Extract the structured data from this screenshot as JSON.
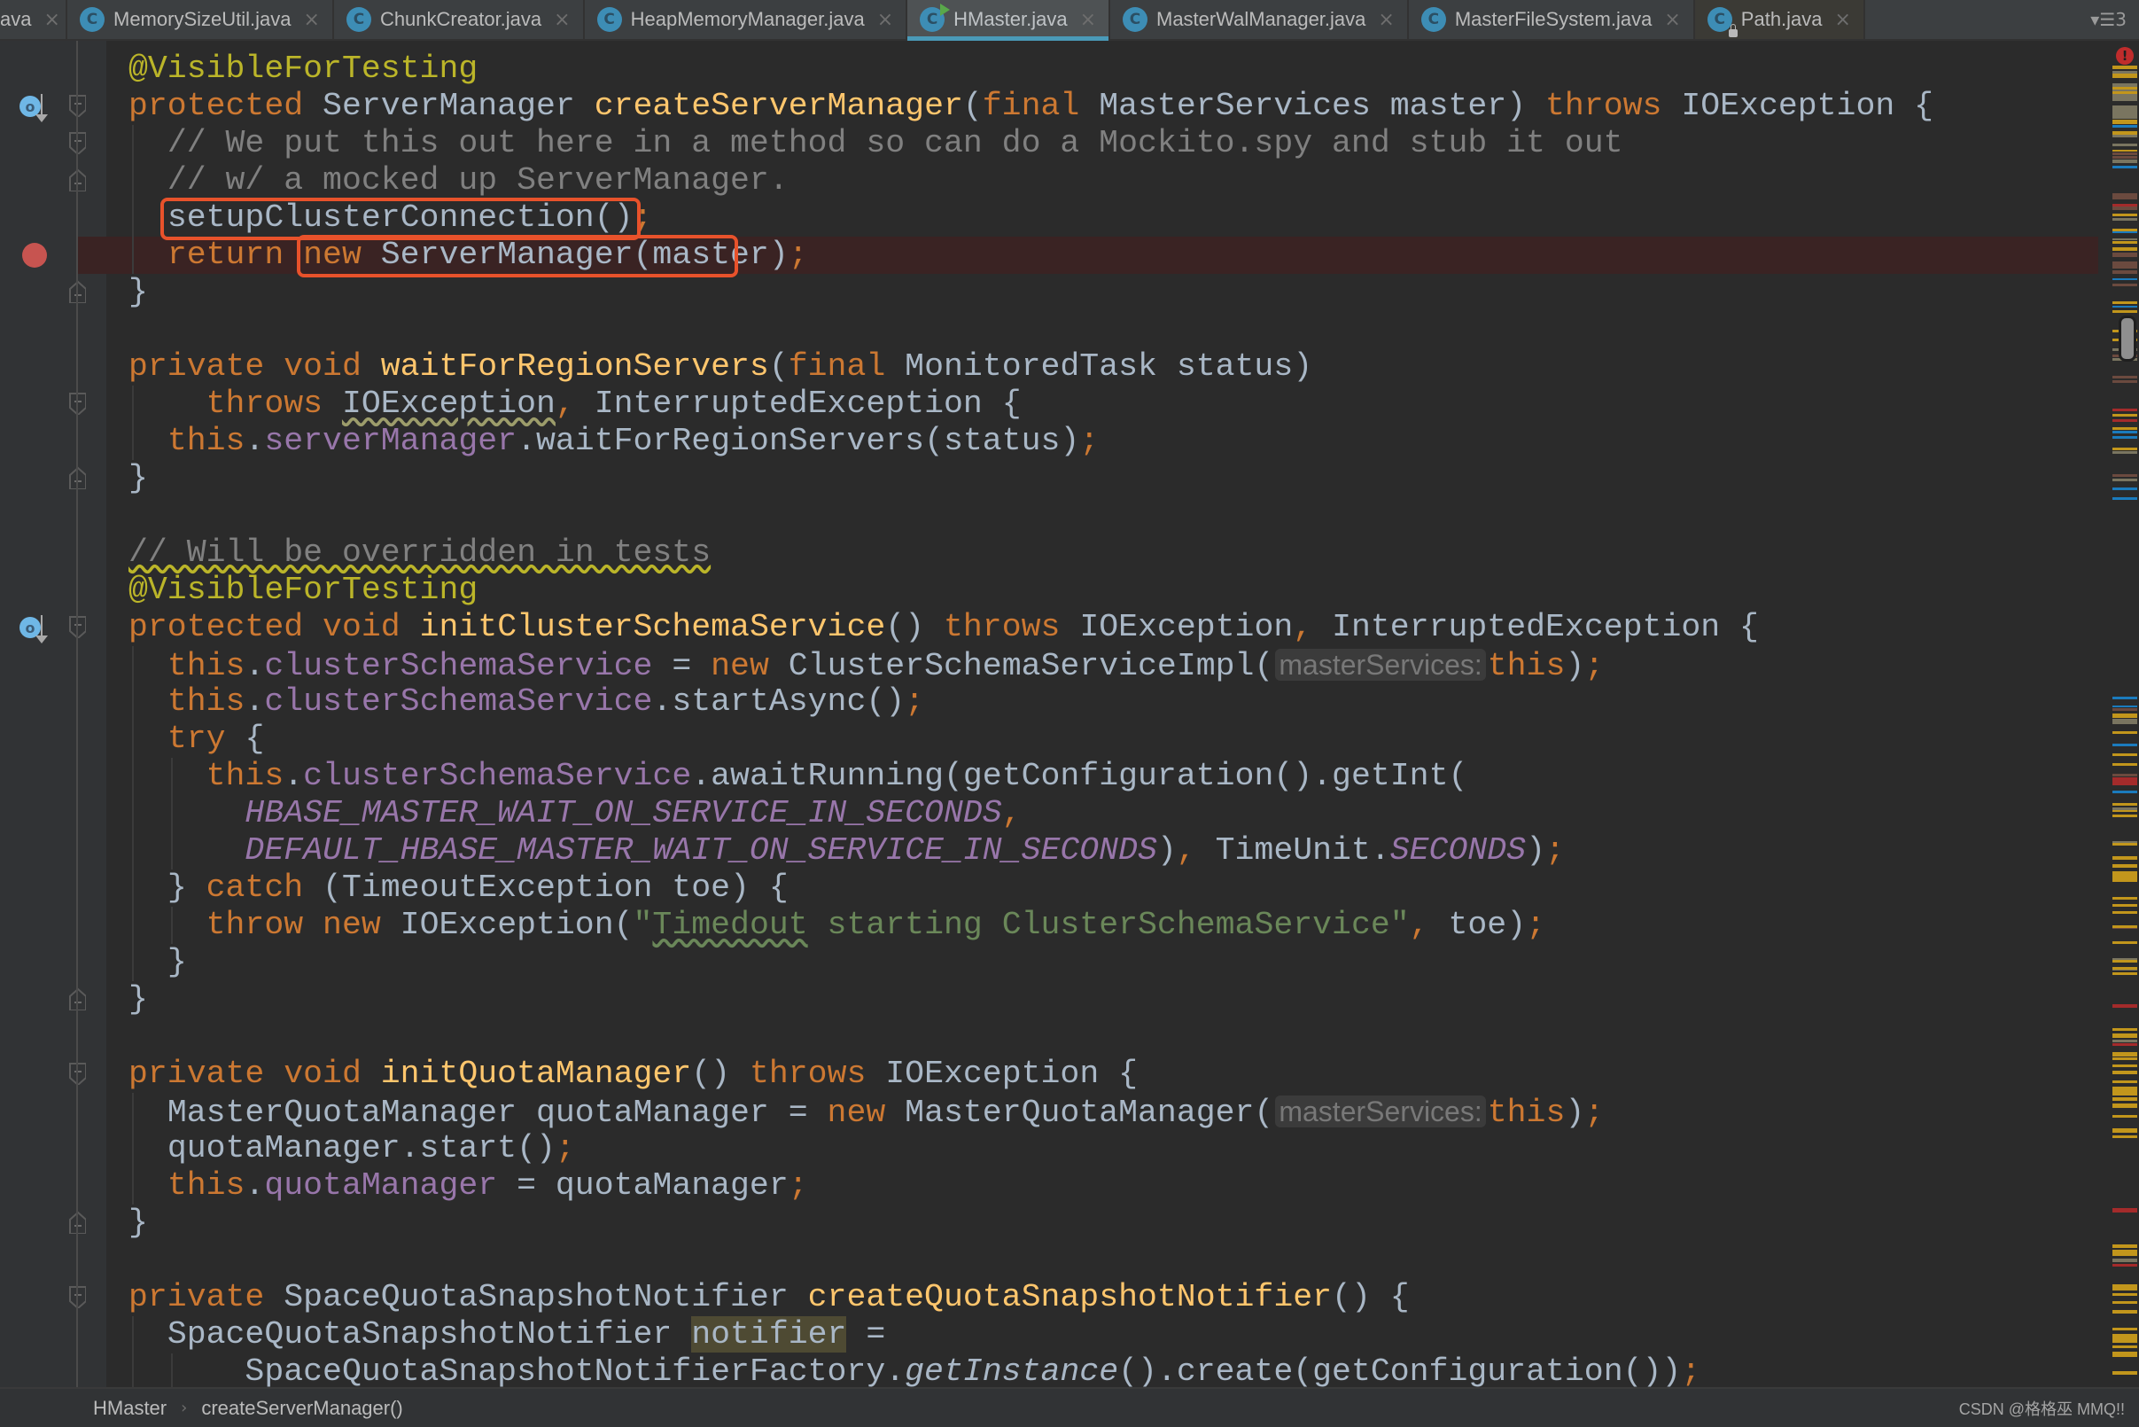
{
  "tabs": [
    {
      "label": "ava",
      "partial": true,
      "active": false,
      "readonly": false,
      "icon": "class-icon"
    },
    {
      "label": "MemorySizeUtil.java",
      "active": false,
      "readonly": false,
      "icon": "class-icon"
    },
    {
      "label": "ChunkCreator.java",
      "active": false,
      "readonly": false,
      "icon": "class-icon"
    },
    {
      "label": "HeapMemoryManager.java",
      "active": false,
      "readonly": false,
      "icon": "class-icon"
    },
    {
      "label": "HMaster.java",
      "active": true,
      "readonly": false,
      "icon": "runnable-class-icon"
    },
    {
      "label": "MasterWalManager.java",
      "active": false,
      "readonly": false,
      "icon": "class-icon"
    },
    {
      "label": "MasterFileSystem.java",
      "active": false,
      "readonly": false,
      "icon": "class-icon"
    },
    {
      "label": "Path.java",
      "active": false,
      "readonly": true,
      "icon": "locked-class-icon"
    }
  ],
  "tab_icon_letter": "C",
  "tab_close_glyph": "×",
  "tab_overflow": {
    "glyph": "▾☰",
    "count": "3"
  },
  "colors": {
    "keyword": "#cc7832",
    "function": "#ffc66d",
    "annotation": "#bbb529",
    "comment": "#808080",
    "field": "#9876aa",
    "string": "#6a8759",
    "text": "#a9b7c6",
    "highlight_box": "#e8522b",
    "breakpoint": "#c75450",
    "active_tab_underline": "#4a9ab8"
  },
  "code": {
    "breakpoint_line": 6,
    "lines": [
      {
        "indent": 0,
        "tokens": [
          {
            "t": "@VisibleForTesting",
            "c": "ann"
          }
        ]
      },
      {
        "indent": 0,
        "gutter": [
          "override-icon"
        ],
        "tokens": [
          {
            "t": "protected ",
            "c": "kw"
          },
          {
            "t": "ServerManager "
          },
          {
            "t": "createServerManager",
            "c": "fn"
          },
          {
            "t": "("
          },
          {
            "t": "final ",
            "c": "kw"
          },
          {
            "t": "MasterServices master) "
          },
          {
            "t": "throws ",
            "c": "kw"
          },
          {
            "t": "IOException {"
          }
        ]
      },
      {
        "indent": 1,
        "tokens": [
          {
            "t": "// We put this out here in a method so can do a Mockito.spy and stub it out",
            "c": "cm"
          }
        ]
      },
      {
        "indent": 1,
        "tokens": [
          {
            "t": "// w/ a mocked up ServerManager.",
            "c": "cm"
          }
        ]
      },
      {
        "indent": 1,
        "tokens": [
          {
            "t": "setupClusterConnection()"
          },
          {
            "t": ";",
            "c": "semi"
          }
        ]
      },
      {
        "indent": 1,
        "gutter": [
          "breakpoint"
        ],
        "tokens": [
          {
            "t": "return ",
            "c": "kw"
          },
          {
            "t": "new ",
            "c": "kw"
          },
          {
            "t": "ServerManager(master)"
          },
          {
            "t": ";",
            "c": "semi"
          }
        ]
      },
      {
        "indent": 0,
        "tokens": [
          {
            "t": "}"
          }
        ]
      },
      {
        "indent": 0,
        "tokens": []
      },
      {
        "indent": 0,
        "tokens": [
          {
            "t": "private ",
            "c": "kw"
          },
          {
            "t": "void ",
            "c": "kw"
          },
          {
            "t": "waitForRegionServers",
            "c": "fn"
          },
          {
            "t": "("
          },
          {
            "t": "final ",
            "c": "kw"
          },
          {
            "t": "MonitoredTask status)"
          }
        ]
      },
      {
        "indent": 2,
        "tokens": [
          {
            "t": "throws ",
            "c": "kw"
          },
          {
            "t": "IOException",
            "c": "warn"
          },
          {
            "t": ", ",
            "c": "semi"
          },
          {
            "t": "InterruptedException {"
          }
        ]
      },
      {
        "indent": 1,
        "tokens": [
          {
            "t": "this",
            "c": "kw"
          },
          {
            "t": "."
          },
          {
            "t": "serverManager",
            "c": "fld"
          },
          {
            "t": ".waitForRegionServers(status)"
          },
          {
            "t": ";",
            "c": "semi"
          }
        ]
      },
      {
        "indent": 0,
        "tokens": [
          {
            "t": "}"
          }
        ]
      },
      {
        "indent": 0,
        "tokens": []
      },
      {
        "indent": 0,
        "tokens": [
          {
            "t": "// Will be overridden in tests",
            "c": "cm cmwarn"
          }
        ]
      },
      {
        "indent": 0,
        "tokens": [
          {
            "t": "@VisibleForTesting",
            "c": "ann"
          }
        ]
      },
      {
        "indent": 0,
        "gutter": [
          "override-icon"
        ],
        "tokens": [
          {
            "t": "protected ",
            "c": "kw"
          },
          {
            "t": "void ",
            "c": "kw"
          },
          {
            "t": "initClusterSchemaService",
            "c": "fn"
          },
          {
            "t": "() "
          },
          {
            "t": "throws ",
            "c": "kw"
          },
          {
            "t": "IOException"
          },
          {
            "t": ", ",
            "c": "semi"
          },
          {
            "t": "InterruptedException {"
          }
        ]
      },
      {
        "indent": 1,
        "tokens": [
          {
            "t": "this",
            "c": "kw"
          },
          {
            "t": "."
          },
          {
            "t": "clusterSchemaService",
            "c": "fld"
          },
          {
            "t": " = "
          },
          {
            "t": "new ",
            "c": "kw"
          },
          {
            "t": "ClusterSchemaServiceImpl("
          },
          {
            "t": "masterServices:",
            "c": "hint"
          },
          {
            "t": "this",
            "c": "kw"
          },
          {
            "t": ")"
          },
          {
            "t": ";",
            "c": "semi"
          }
        ]
      },
      {
        "indent": 1,
        "tokens": [
          {
            "t": "this",
            "c": "kw"
          },
          {
            "t": "."
          },
          {
            "t": "clusterSchemaService",
            "c": "fld"
          },
          {
            "t": ".startAsync()"
          },
          {
            "t": ";",
            "c": "semi"
          }
        ]
      },
      {
        "indent": 1,
        "tokens": [
          {
            "t": "try ",
            "c": "kw"
          },
          {
            "t": "{"
          }
        ]
      },
      {
        "indent": 2,
        "tokens": [
          {
            "t": "this",
            "c": "kw"
          },
          {
            "t": "."
          },
          {
            "t": "clusterSchemaService",
            "c": "fld"
          },
          {
            "t": ".awaitRunning(getConfiguration().getInt("
          }
        ]
      },
      {
        "indent": 3,
        "tokens": [
          {
            "t": "HBASE_MASTER_WAIT_ON_SERVICE_IN_SECONDS",
            "c": "const"
          },
          {
            "t": ",",
            "c": "semi"
          }
        ]
      },
      {
        "indent": 3,
        "tokens": [
          {
            "t": "DEFAULT_HBASE_MASTER_WAIT_ON_SERVICE_IN_SECONDS",
            "c": "const"
          },
          {
            "t": ")"
          },
          {
            "t": ", ",
            "c": "semi"
          },
          {
            "t": "TimeUnit."
          },
          {
            "t": "SECONDS",
            "c": "const"
          },
          {
            "t": ")"
          },
          {
            "t": ";",
            "c": "semi"
          }
        ]
      },
      {
        "indent": 1,
        "tokens": [
          {
            "t": "} "
          },
          {
            "t": "catch ",
            "c": "kw"
          },
          {
            "t": "(TimeoutException toe) {"
          }
        ]
      },
      {
        "indent": 2,
        "tokens": [
          {
            "t": "throw ",
            "c": "kw"
          },
          {
            "t": "new ",
            "c": "kw"
          },
          {
            "t": "IOException("
          },
          {
            "t": "\"",
            "c": "str"
          },
          {
            "t": "Timedout",
            "c": "str typo"
          },
          {
            "t": " starting ClusterSchemaService\"",
            "c": "str"
          },
          {
            "t": ", ",
            "c": "semi"
          },
          {
            "t": "toe)"
          },
          {
            "t": ";",
            "c": "semi"
          }
        ]
      },
      {
        "indent": 1,
        "tokens": [
          {
            "t": "}"
          }
        ]
      },
      {
        "indent": 0,
        "tokens": [
          {
            "t": "}"
          }
        ]
      },
      {
        "indent": 0,
        "tokens": []
      },
      {
        "indent": 0,
        "tokens": [
          {
            "t": "private ",
            "c": "kw"
          },
          {
            "t": "void ",
            "c": "kw"
          },
          {
            "t": "initQuotaManager",
            "c": "fn"
          },
          {
            "t": "() "
          },
          {
            "t": "throws ",
            "c": "kw"
          },
          {
            "t": "IOException {"
          }
        ]
      },
      {
        "indent": 1,
        "tokens": [
          {
            "t": "MasterQuotaManager quotaManager = "
          },
          {
            "t": "new ",
            "c": "kw"
          },
          {
            "t": "MasterQuotaManager("
          },
          {
            "t": "masterServices:",
            "c": "hint"
          },
          {
            "t": "this",
            "c": "kw"
          },
          {
            "t": ")"
          },
          {
            "t": ";",
            "c": "semi"
          }
        ]
      },
      {
        "indent": 1,
        "tokens": [
          {
            "t": "quotaManager.start()"
          },
          {
            "t": ";",
            "c": "semi"
          }
        ]
      },
      {
        "indent": 1,
        "tokens": [
          {
            "t": "this",
            "c": "kw"
          },
          {
            "t": "."
          },
          {
            "t": "quotaManager",
            "c": "fld"
          },
          {
            "t": " = quotaManager"
          },
          {
            "t": ";",
            "c": "semi"
          }
        ]
      },
      {
        "indent": 0,
        "tokens": [
          {
            "t": "}"
          }
        ]
      },
      {
        "indent": 0,
        "tokens": []
      },
      {
        "indent": 0,
        "tokens": [
          {
            "t": "private ",
            "c": "kw"
          },
          {
            "t": "SpaceQuotaSnapshotNotifier "
          },
          {
            "t": "createQuotaSnapshotNotifier",
            "c": "fn"
          },
          {
            "t": "() {"
          }
        ]
      },
      {
        "indent": 1,
        "tokens": [
          {
            "t": "SpaceQuotaSnapshotNotifier "
          },
          {
            "t": "notifier",
            "c": "mark"
          },
          {
            "t": " ="
          }
        ]
      },
      {
        "indent": 3,
        "tokens": [
          {
            "t": "SpaceQuotaSnapshotNotifierFactory."
          },
          {
            "t": "getInstance",
            "c": "it"
          },
          {
            "t": "().create(getConfiguration())"
          },
          {
            "t": ";",
            "c": "semi"
          }
        ]
      }
    ]
  },
  "breadcrumb": {
    "items": [
      "HMaster",
      "createServerManager()"
    ],
    "separator": "›"
  },
  "watermark": "CSDN @格格巫 MMQ!!",
  "error_stripe": {
    "error_glyph": "!"
  }
}
